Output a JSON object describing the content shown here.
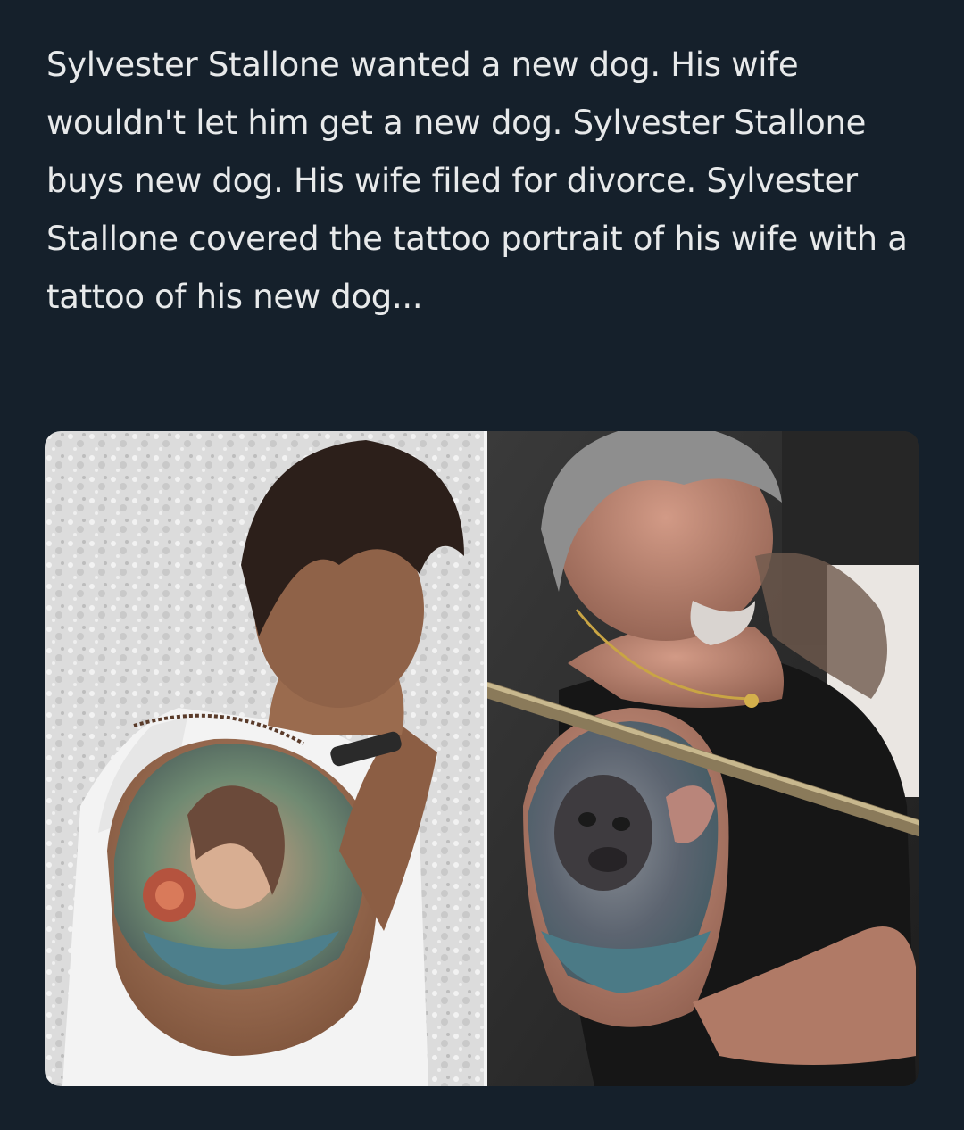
{
  "tweet": {
    "text": "Sylvester Stallone wanted a new dog. His wife wouldn't let him get a new dog. Sylvester Stallone buys new dog. His wife filed for divorce. Sylvester Stallone covered the tattoo portrait of his wife with a tattoo of his new dog..."
  },
  "media": {
    "images": [
      {
        "description_name": "before-tattoo-photo"
      },
      {
        "description_name": "after-tattoo-photo"
      }
    ]
  },
  "colors": {
    "background": "#15202b",
    "text": "#e7e9ea"
  }
}
